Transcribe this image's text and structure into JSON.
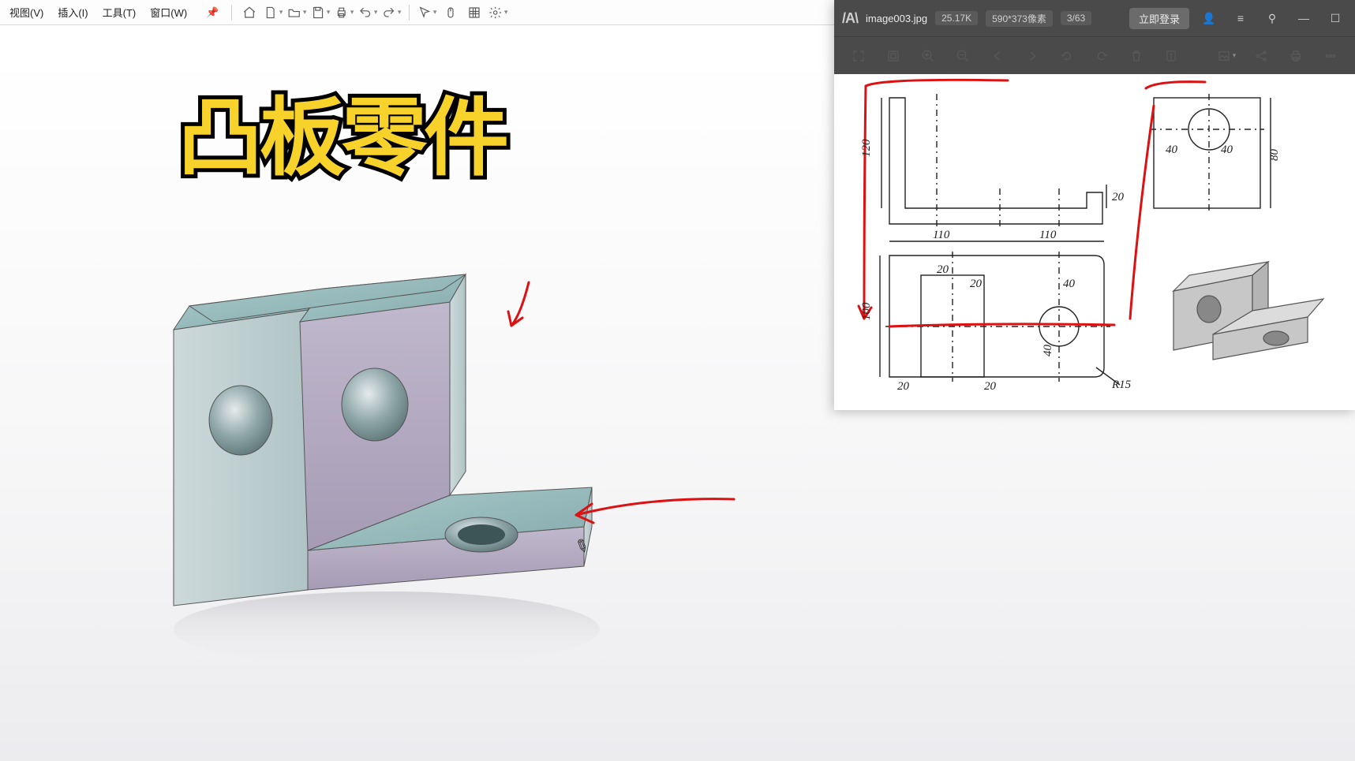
{
  "cad": {
    "menubar": {
      "view": "视图(V)",
      "insert": "插入(I)",
      "tools": "工具(T)",
      "window": "窗口(W)"
    },
    "big_title": "凸板零件"
  },
  "viewer": {
    "filename": "image003.jpg",
    "filesize": "25.17K",
    "pixels": "590*373像素",
    "page": "3/63",
    "login": "立即登录"
  },
  "drawing": {
    "dims": {
      "dim_120": "120",
      "dim_20_side": "20",
      "dim_40_side_a": "40",
      "dim_40_side_b": "40",
      "dim_80": "80",
      "dim_110_a": "110",
      "dim_110_b": "110",
      "dim_100": "100",
      "dim_20_top_a": "20",
      "dim_20_top_b": "20",
      "dim_20_bottom_a": "20",
      "dim_20_bottom_b": "20",
      "dim_40_top": "40",
      "dim_40_top_b": "40",
      "dim_r15": "R15"
    }
  }
}
